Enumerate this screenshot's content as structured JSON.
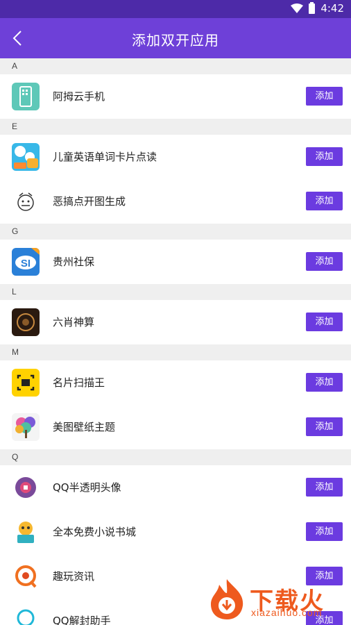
{
  "status_bar": {
    "time": "4:42"
  },
  "app_bar": {
    "title": "添加双开应用"
  },
  "add_label": "添加",
  "sections": [
    {
      "letter": "A",
      "apps": [
        {
          "name": "阿拇云手机",
          "icon": "cloud-phone-icon"
        }
      ]
    },
    {
      "letter": "E",
      "apps": [
        {
          "name": "儿童英语单词卡片点读",
          "icon": "abc-cards-icon"
        },
        {
          "name": "恶搞点开图生成",
          "icon": "sketch-face-icon"
        }
      ]
    },
    {
      "letter": "G",
      "apps": [
        {
          "name": "贵州社保",
          "icon": "si-logo-icon"
        }
      ]
    },
    {
      "letter": "L",
      "apps": [
        {
          "name": "六肖神算",
          "icon": "dark-seal-icon"
        }
      ]
    },
    {
      "letter": "M",
      "apps": [
        {
          "name": "名片扫描王",
          "icon": "card-scan-icon"
        },
        {
          "name": "美图壁纸主题",
          "icon": "colorful-tree-icon"
        }
      ]
    },
    {
      "letter": "Q",
      "apps": [
        {
          "name": "QQ半透明头像",
          "icon": "purple-avatar-icon"
        },
        {
          "name": "全本免费小说书城",
          "icon": "tiger-reader-icon"
        },
        {
          "name": "趣玩资讯",
          "icon": "orange-q-icon"
        },
        {
          "name": "QQ解封助手",
          "icon": "teal-person-icon"
        }
      ]
    }
  ],
  "watermark": {
    "brand": "下载火",
    "domain": "xiazaihuo.com"
  },
  "colors": {
    "status_bar": "#4d2aa8",
    "app_bar": "#6e40d8",
    "button": "#6b3be0",
    "watermark": "#ee5a1e"
  }
}
